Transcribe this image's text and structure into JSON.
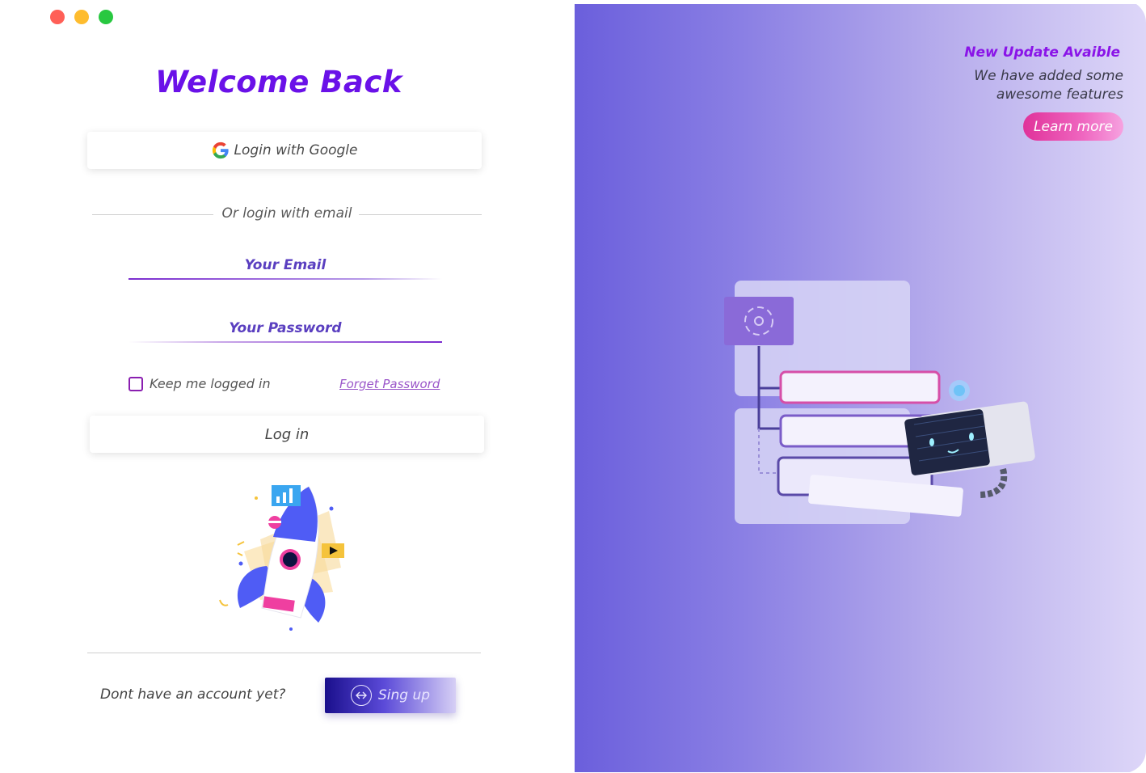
{
  "window": {
    "controls": [
      "close",
      "minimize",
      "maximize"
    ]
  },
  "login": {
    "title": "Welcome Back",
    "google_button": "Login with Google",
    "divider_text": "Or login with email",
    "email_placeholder": "Your Email",
    "password_placeholder": "Your Password",
    "remember_label": "Keep me logged in",
    "forget_link": "Forget Password",
    "login_button": "Log in",
    "no_account_text": "Dont have an account yet?",
    "signup_button": "Sing up"
  },
  "promo": {
    "update_title": "New Update Avaible",
    "update_text": "We have added some awesome features",
    "learn_more_button": "Learn more"
  },
  "colors": {
    "accent": "#6a11e8",
    "panel_gradient_start": "#6b5fdc",
    "panel_gradient_end": "#ddd6f8",
    "learn_more_pink": "#e0329a"
  },
  "icons": [
    "google-icon",
    "signup-icon",
    "rocket-illustration",
    "robot-illustration"
  ]
}
